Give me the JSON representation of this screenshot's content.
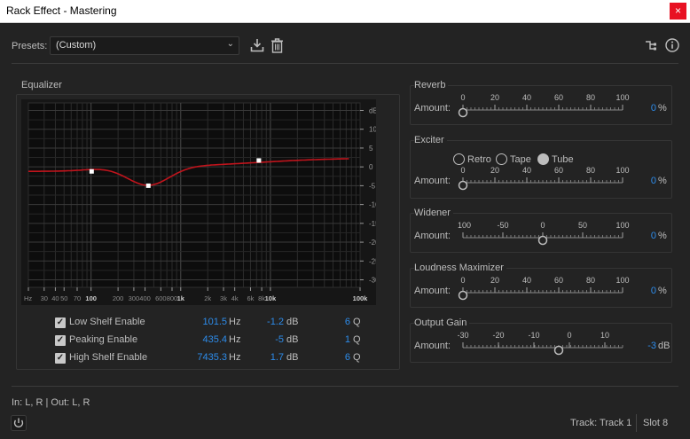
{
  "window": {
    "title": "Rack Effect - Mastering",
    "close_glyph": "×"
  },
  "presets": {
    "label": "Presets:",
    "value": "(Custom)",
    "icons": [
      "save-preset-icon",
      "delete-preset-icon",
      "routing-icon",
      "info-icon"
    ]
  },
  "equalizer": {
    "title": "Equalizer",
    "freq_ticks": [
      "Hz",
      "30",
      "40",
      "50",
      "70",
      "100",
      "200",
      "300",
      "400",
      "600",
      "800",
      "1k",
      "2k",
      "3k",
      "4k",
      "6k",
      "8k",
      "10k",
      "100k"
    ],
    "db_ticks": [
      "dB",
      "10",
      "5",
      "0",
      "-5",
      "-10",
      "-15",
      "-20",
      "-25",
      "-30"
    ],
    "bands": [
      {
        "name": "Low Shelf Enable",
        "checked": true,
        "freq": "101.5",
        "freq_unit": "Hz",
        "gain": "-1.2",
        "gain_unit": "dB",
        "q": "6",
        "q_unit": "Q"
      },
      {
        "name": "Peaking Enable",
        "checked": true,
        "freq": "435.4",
        "freq_unit": "Hz",
        "gain": "-5",
        "gain_unit": "dB",
        "q": "1",
        "q_unit": "Q"
      },
      {
        "name": "High Shelf Enable",
        "checked": true,
        "freq": "7435.3",
        "freq_unit": "Hz",
        "gain": "1.7",
        "gain_unit": "dB",
        "q": "6",
        "q_unit": "Q"
      }
    ],
    "curve_color": "#c0141c"
  },
  "reverb": {
    "title": "Reverb",
    "amount_label": "Amount:",
    "ticks": [
      "0",
      "20",
      "40",
      "60",
      "80",
      "100"
    ],
    "value": "0",
    "unit": "%",
    "min": 0,
    "max": 100,
    "level": 0
  },
  "exciter": {
    "title": "Exciter",
    "modes": [
      "Retro",
      "Tape",
      "Tube"
    ],
    "selected_mode": "Tube",
    "amount_label": "Amount:",
    "ticks": [
      "0",
      "20",
      "40",
      "60",
      "80",
      "100"
    ],
    "value": "0",
    "unit": "%",
    "min": 0,
    "max": 100,
    "level": 0
  },
  "widener": {
    "title": "Widener",
    "amount_label": "Amount:",
    "ticks": [
      "-100",
      "-50",
      "0",
      "50",
      "100"
    ],
    "value": "0",
    "unit": "%",
    "min": -100,
    "max": 100,
    "level": 0
  },
  "loudness": {
    "title": "Loudness Maximizer",
    "amount_label": "Amount:",
    "ticks": [
      "0",
      "20",
      "40",
      "60",
      "80",
      "100"
    ],
    "value": "0",
    "unit": "%",
    "min": 0,
    "max": 100,
    "level": 0
  },
  "output_gain": {
    "title": "Output Gain",
    "amount_label": "Amount:",
    "ticks": [
      "-30",
      "-20",
      "-10",
      "0",
      "10"
    ],
    "value": "-3",
    "unit": "dB",
    "min": -30,
    "max": 15,
    "level": -3
  },
  "footer": {
    "io": "In: L, R | Out: L, R",
    "track": "Track: Track 1",
    "slot": "Slot 8",
    "accent": "#2d8ceb"
  }
}
